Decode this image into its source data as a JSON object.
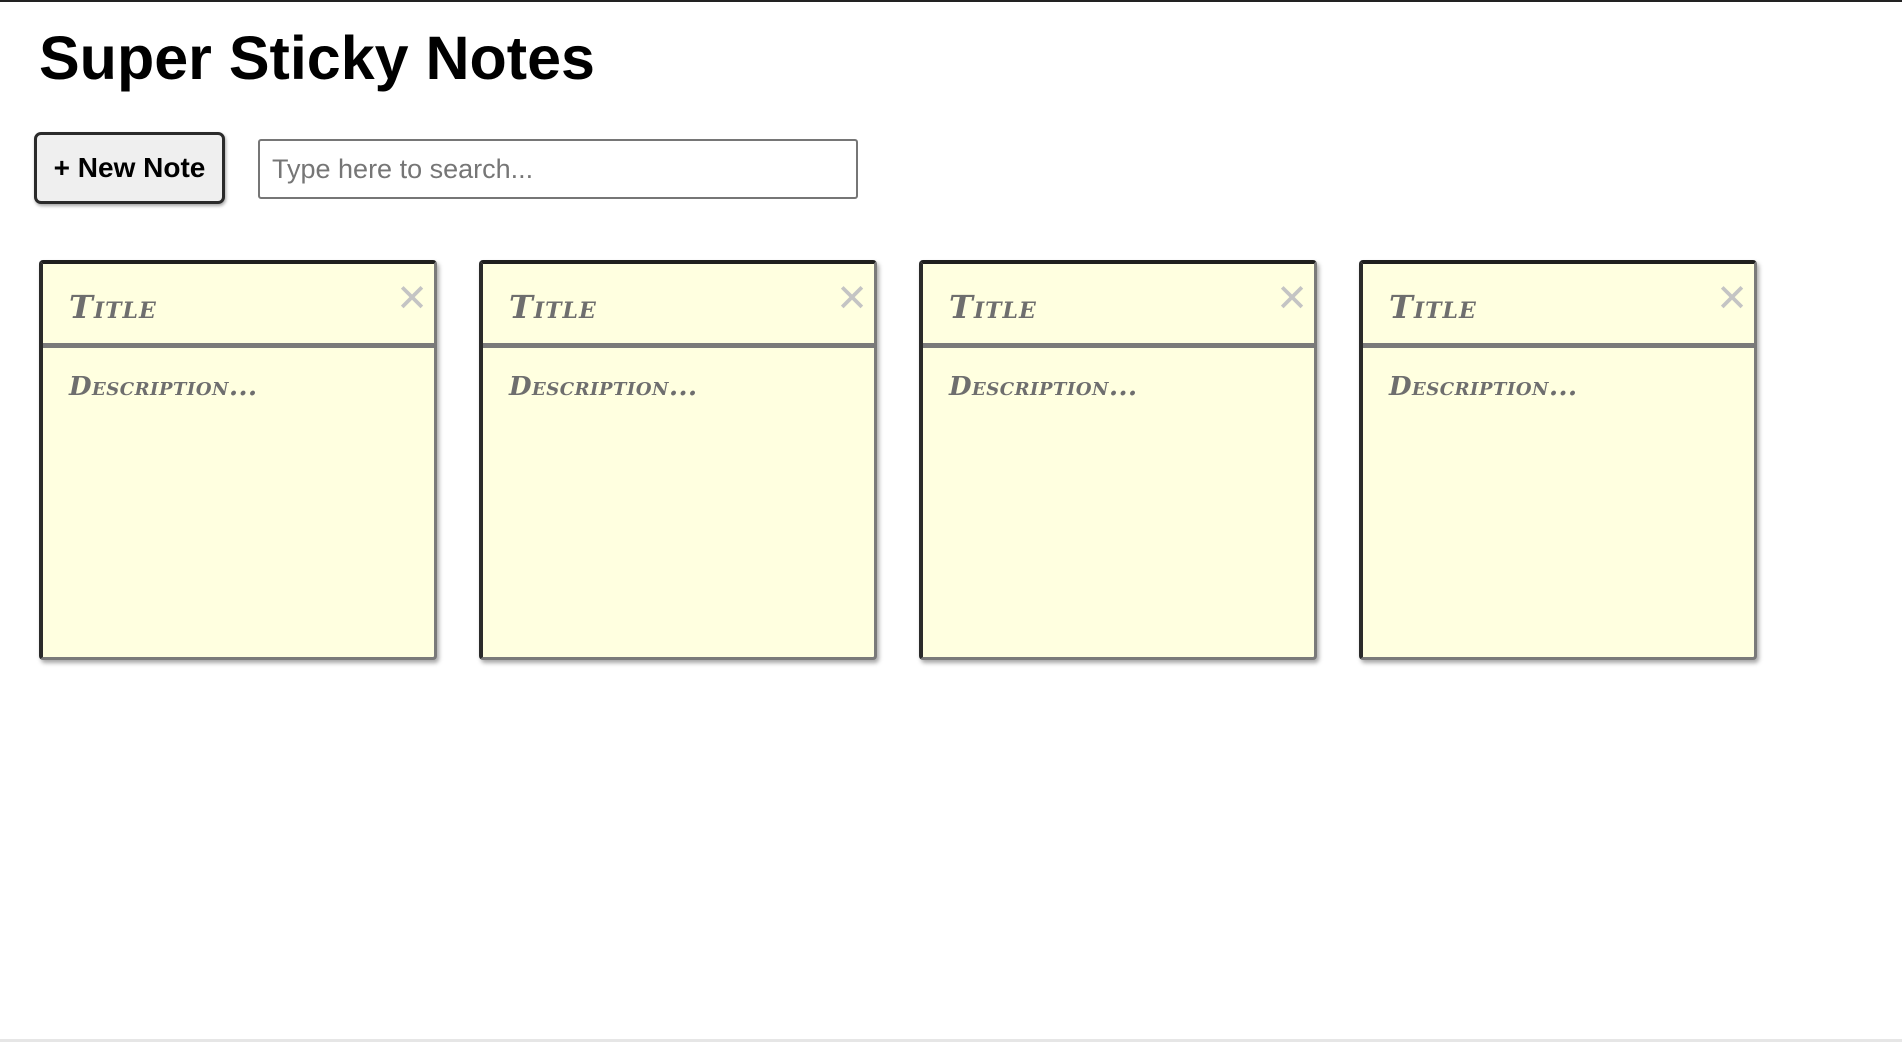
{
  "header": {
    "title": "Super Sticky Notes"
  },
  "toolbar": {
    "new_note_label": "+ New Note",
    "search_placeholder": "Type here to search...",
    "search_value": ""
  },
  "notes": [
    {
      "title": "Title",
      "description": "Description...",
      "close_glyph": "✕"
    },
    {
      "title": "Title",
      "description": "Description...",
      "close_glyph": "✕"
    },
    {
      "title": "Title",
      "description": "Description...",
      "close_glyph": "✕"
    },
    {
      "title": "Title",
      "description": "Description...",
      "close_glyph": "✕"
    }
  ],
  "colors": {
    "note_background": "#ffffe0",
    "note_text": "#6e6e6e",
    "close_icon": "#c4c4c4",
    "button_background": "#efefef"
  }
}
